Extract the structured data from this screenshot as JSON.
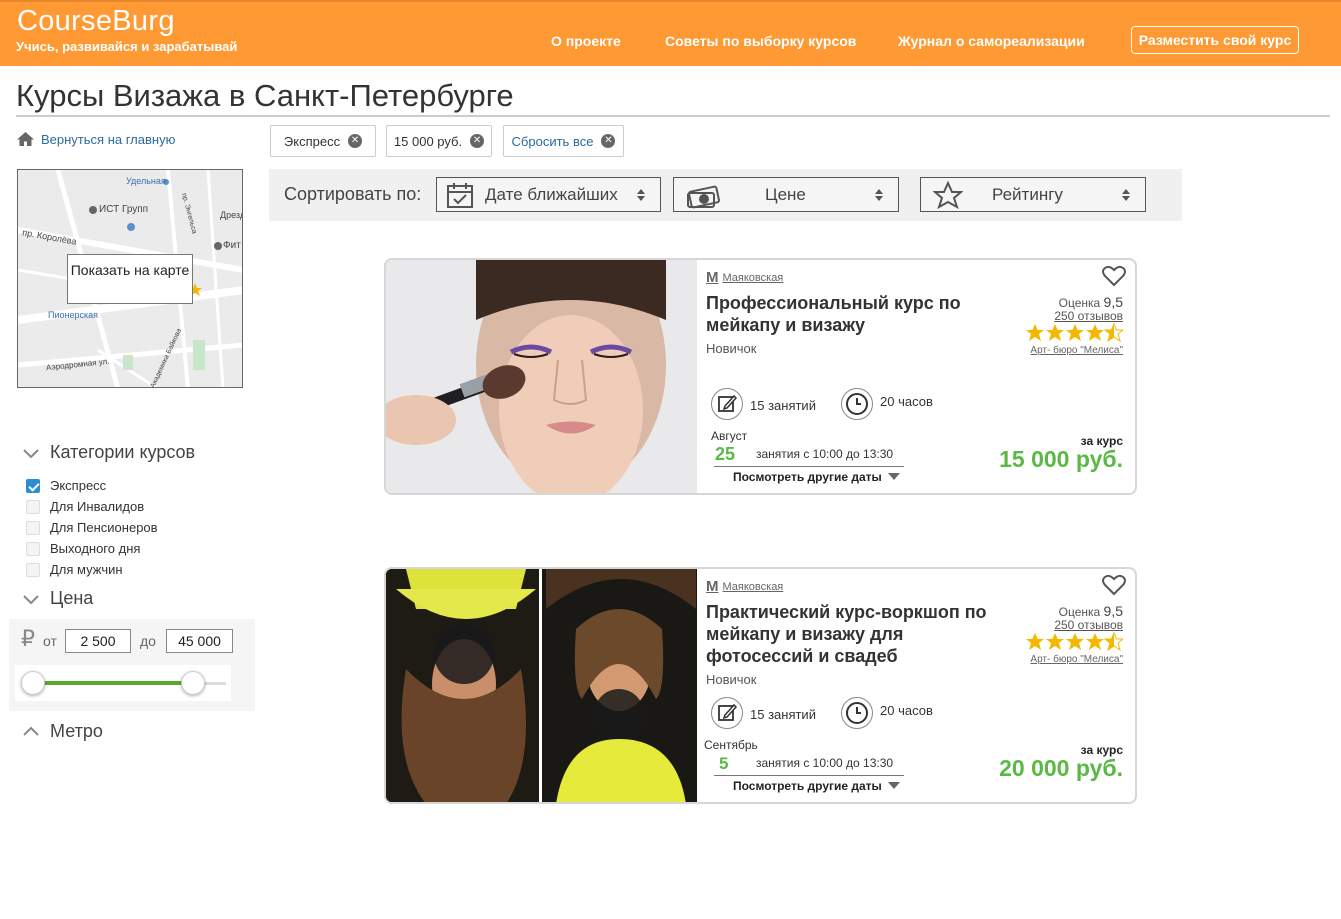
{
  "header": {
    "logo": "CourseBurg",
    "tagline": "Учись, развивайся и зарабатывай",
    "nav": [
      "О проекте",
      "Советы по выборку курсов",
      "Журнал о самореализации"
    ],
    "cta": "Разместить свой курс",
    "color": "#FF9933"
  },
  "page_title": "Курсы Визажа в Санкт-Петербурге",
  "sidebar": {
    "back_link": "Вернуться на главную",
    "map": {
      "button": "Показать на карте",
      "labels": [
        "Удельная",
        "ИСТ Групп",
        "пр. Королёва",
        "Фит",
        "Пионерская",
        "Аэродромная ул.",
        "ул. Академика Байкова",
        "пр. Энгельса",
        "Дрезд"
      ]
    },
    "categories": {
      "title": "Категории курсов",
      "items": [
        {
          "label": "Экспресс",
          "checked": true
        },
        {
          "label": "Для Инвалидов",
          "checked": false
        },
        {
          "label": "Для Пенсионеров",
          "checked": false
        },
        {
          "label": "Выходного дня",
          "checked": false
        },
        {
          "label": "Для мужчин",
          "checked": false
        }
      ]
    },
    "price": {
      "title": "Цена",
      "currency": "₽",
      "from_label": "от",
      "to_label": "до",
      "from_value": "2 500",
      "to_value": "45 000"
    },
    "metro": {
      "title": "Метро"
    }
  },
  "filters": {
    "chips": [
      "Экспресс",
      "15 000 руб."
    ],
    "reset": "Сбросить все"
  },
  "sort": {
    "label": "Сортировать по:",
    "options": [
      "Дате ближайших",
      "Цене",
      "Рейтингу"
    ]
  },
  "courses": [
    {
      "metro": "Маяковская",
      "title": "Профессиональный курс по мейкапу и визажу",
      "level": "Новичок",
      "rating_label": "Оценка",
      "rating": "9,5",
      "reviews": "250 отзывов",
      "stars": 4.5,
      "school": "Арт- бюро \"Мелиса\"",
      "lessons": "15 занятий",
      "hours": "20 часов",
      "month": "Август",
      "day": "25",
      "schedule": "занятия с 10:00 до 13:30",
      "other_dates": "Посмотреть другие даты",
      "per_course": "за курс",
      "price": "15 000 руб."
    },
    {
      "metro": "Маяковская",
      "title": "Практический курс-воркшоп по мейкапу и визажу для фотосессий и свадеб",
      "level": "Новичок",
      "rating_label": "Оценка",
      "rating": "9,5",
      "reviews": "250 отзывов",
      "stars": 4.5,
      "school": "Арт- бюро \"Мелиса\"",
      "lessons": "15 занятий",
      "hours": "20 часов",
      "month": "Сентябрь",
      "day": "5",
      "schedule": "занятия с 10:00 до 13:30",
      "other_dates": "Посмотреть другие даты",
      "per_course": "за курс",
      "price": "20 000 руб."
    }
  ],
  "colors": {
    "accent": "#FF9933",
    "price": "#5ab945",
    "link": "#2b6aa0",
    "star": "#f5b800"
  }
}
